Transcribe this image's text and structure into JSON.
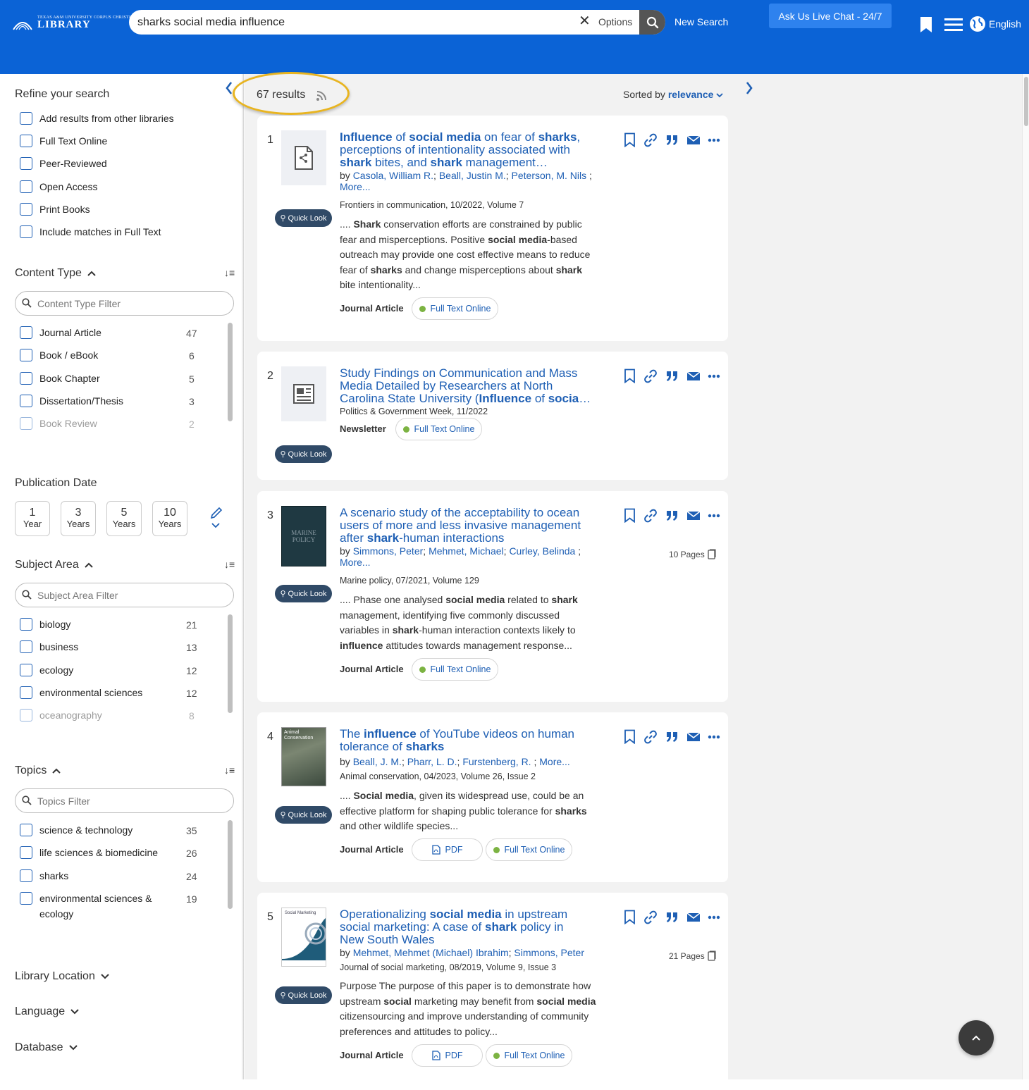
{
  "header": {
    "logo_small": "TEXAS A&M UNIVERSITY CORPUS CHRISTI | MARY AND JEFF BELL",
    "logo_big": "LIBRARY",
    "search_value": "sharks social media influence",
    "options_label": "Options",
    "new_search_label": "New Search",
    "chat_label": "Ask Us Live Chat - 24/7",
    "language_label": "English"
  },
  "sidebar": {
    "refine_title": "Refine your search",
    "refine_options": [
      "Add results from other libraries",
      "Full Text Online",
      "Peer-Reviewed",
      "Open Access",
      "Print Books",
      "Include matches in Full Text"
    ],
    "content_type": {
      "title": "Content Type",
      "filter_placeholder": "Content Type Filter",
      "items": [
        {
          "label": "Journal Article",
          "count": "47"
        },
        {
          "label": "Book / eBook",
          "count": "6"
        },
        {
          "label": "Book Chapter",
          "count": "5"
        },
        {
          "label": "Dissertation/Thesis",
          "count": "3"
        },
        {
          "label": "Book Review",
          "count": "2"
        }
      ]
    },
    "publication_date": {
      "title": "Publication Date",
      "buttons": [
        {
          "num": "1",
          "unit": "Year"
        },
        {
          "num": "3",
          "unit": "Years"
        },
        {
          "num": "5",
          "unit": "Years"
        },
        {
          "num": "10",
          "unit": "Years"
        }
      ]
    },
    "subject_area": {
      "title": "Subject Area",
      "filter_placeholder": "Subject Area Filter",
      "items": [
        {
          "label": "biology",
          "count": "21"
        },
        {
          "label": "business",
          "count": "13"
        },
        {
          "label": "ecology",
          "count": "12"
        },
        {
          "label": "environmental sciences",
          "count": "12"
        },
        {
          "label": "oceanography",
          "count": "8"
        }
      ]
    },
    "topics": {
      "title": "Topics",
      "filter_placeholder": "Topics Filter",
      "items": [
        {
          "label": "science & technology",
          "count": "35"
        },
        {
          "label": "life sciences & biomedicine",
          "count": "26"
        },
        {
          "label": "sharks",
          "count": "24"
        },
        {
          "label": "environmental sciences & ecology",
          "count": "19"
        }
      ]
    },
    "collapsed_sections": [
      "Library Location",
      "Language",
      "Database"
    ]
  },
  "results": {
    "count_label": "67 results",
    "sorted_by_label": "Sorted by",
    "sorted_by_value": "relevance",
    "quick_look_label": "Quick Look",
    "full_text_label": "Full Text Online",
    "pdf_label": "PDF",
    "items": [
      {
        "num": "1",
        "title": "Influence of social media on fear of sharks, perceptions of intentionality associated with shark bites, and shark management…",
        "by": "by",
        "authors": [
          "Casola, William R.",
          "Beall, Justin M.",
          "Peterson, M. Nils"
        ],
        "more": "More...",
        "source": "Frontiers in communication, 10/2022, Volume 7",
        "snippet": ".... Shark conservation efforts are constrained by public fear and misperceptions. Positive social media-based outreach may provide one cost effective means to reduce fear of sharks and change misperceptions about shark bite intentionality...",
        "type": "Journal Article"
      },
      {
        "num": "2",
        "title": "Study Findings on Communication and Mass Media Detailed by Researchers at North Carolina State University (Influence of socia…",
        "source": "Politics & Government Week, 11/2022",
        "type": "Newsletter"
      },
      {
        "num": "3",
        "title": "A scenario study of the acceptability to ocean users of more and less invasive management after shark-human interactions",
        "by": "by",
        "authors": [
          "Simmons, Peter",
          "Mehmet, Michael",
          "Curley, Belinda"
        ],
        "more": "More...",
        "source": "Marine policy, 07/2021, Volume 129",
        "snippet": ".... Phase one analysed social media related to shark management, identifying five commonly discussed variables in shark-human interaction contexts likely to influence attitudes towards management response...",
        "type": "Journal Article",
        "pages": "10 Pages"
      },
      {
        "num": "4",
        "title": "The influence of YouTube videos on human tolerance of sharks",
        "by": "by",
        "authors": [
          "Beall, J. M.",
          "Pharr, L. D.",
          "Furstenberg, R."
        ],
        "more": "More...",
        "source": "Animal conservation, 04/2023, Volume 26, Issue 2",
        "snippet": ".... Social media, given its widespread use, could be an effective platform for shaping public tolerance for sharks and other wildlife species...",
        "type": "Journal Article"
      },
      {
        "num": "5",
        "title": "Operationalizing social media in upstream social marketing: A case of shark policy in New South Wales",
        "by": "by",
        "authors": [
          "Mehmet, Mehmet (Michael) Ibrahim",
          "Simmons, Peter"
        ],
        "source": "Journal of social marketing, 08/2019, Volume 9, Issue 3",
        "snippet": "Purpose The purpose of this paper is to demonstrate how upstream social marketing may benefit from social media citizensourcing and improve understanding of community preferences and attitudes to policy...",
        "type": "Journal Article",
        "pages": "21 Pages"
      }
    ]
  },
  "thumbs": {
    "r3_cover_text": "MARINE POLICY",
    "r4_cover_text": "Animal Conservation",
    "r5_cover_text": "Social Marketing"
  },
  "colors": {
    "header_blue": "#0b63d6",
    "link_blue": "#1e5fb4",
    "quicklook": "#304a67",
    "highlight": "#e8b420"
  }
}
